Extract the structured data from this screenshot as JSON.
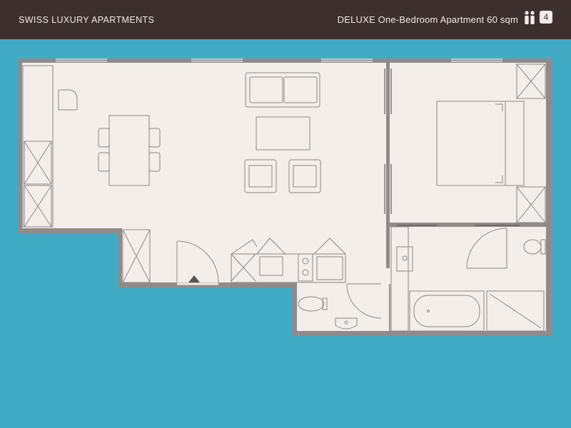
{
  "header": {
    "brand": "SWISS LUXURY APARTMENTS",
    "apartment_title": "DELUXE One-Bedroom Apartment 60 sqm",
    "guest_icon": "two-persons-icon",
    "guest_count": "4"
  },
  "colors": {
    "header_bg": "#3c2f2d",
    "page_bg": "#41abc6",
    "wall": "#8f8b8a",
    "floor": "#f4eeea",
    "furniture_stroke": "#8a8785"
  },
  "floorplan": {
    "icons": [
      "sofa-icon",
      "coffee-table-icon",
      "armchair-icon",
      "dining-table-icon",
      "chair-icon",
      "double-bed-icon",
      "wardrobe-icon",
      "bathtub-icon",
      "shower-icon",
      "toilet-icon",
      "sink-icon",
      "stove-icon",
      "door-icon",
      "entrance-arrow-icon"
    ]
  }
}
